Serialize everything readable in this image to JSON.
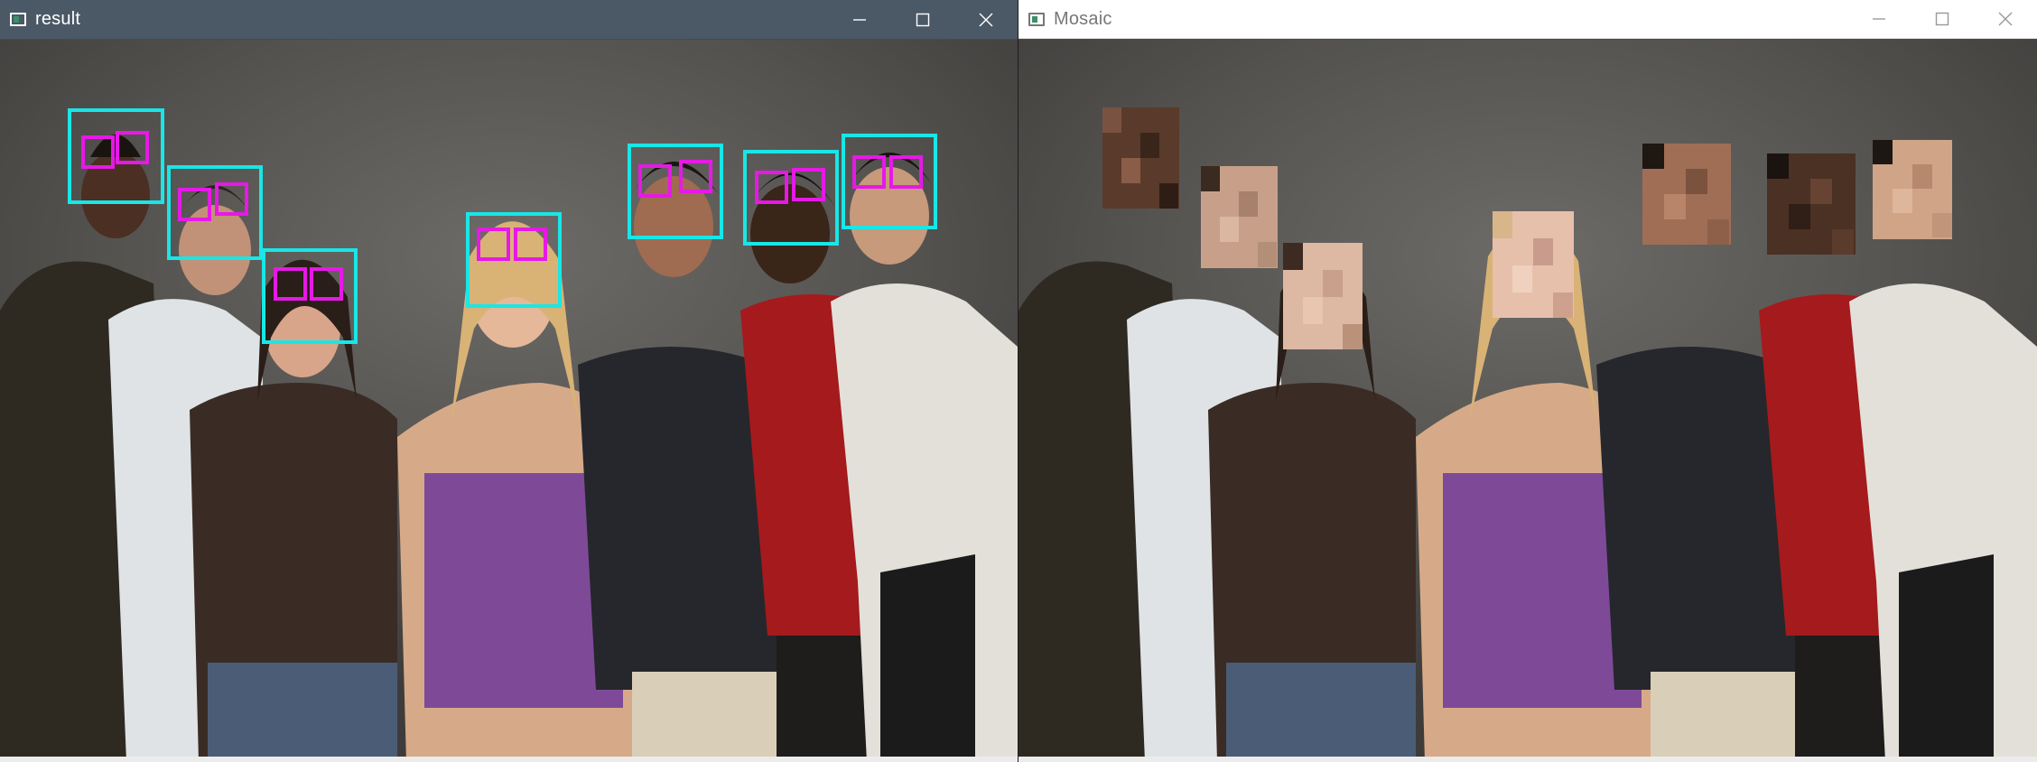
{
  "windows": {
    "result": {
      "title": "result"
    },
    "mosaic": {
      "title": "Mosaic"
    }
  },
  "titlebar_buttons": {
    "minimize": "minimize-icon",
    "maximize": "maximize-icon",
    "close": "close-icon"
  },
  "colors": {
    "face_box": "#19e6e6",
    "eye_box": "#e619e6",
    "result_titlebar": "#4b5866",
    "mosaic_titlebar": "#ffffff"
  }
}
